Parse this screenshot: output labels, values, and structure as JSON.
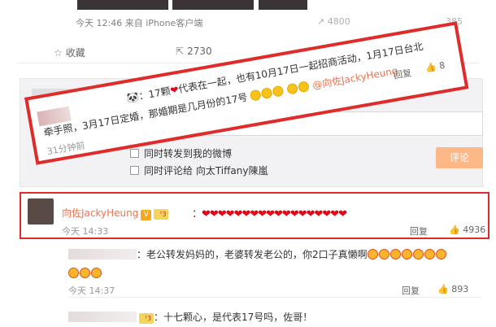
{
  "post": {
    "meta": "今天 12:46 来自 iPhone客户端",
    "share_count_partial": "4800",
    "like_count_partial": "385"
  },
  "actions": {
    "favorite": "收藏",
    "repost_count": "2730"
  },
  "composer": {
    "option_repost": "同时转发到我的微博",
    "option_comment": "同时评论给 向太Tiffany陳嵐",
    "submit": "评论"
  },
  "highlighted_reply": {
    "line1_prefix": "：17颗",
    "line1_mid": "代表在一起，也有10月17日一起招商活动，1月17日台北",
    "mention": "@向佐JackyHeung",
    "line2": "牵手照，3月17日定婚，那婚期是几月份的17号",
    "time": "31分钟前",
    "reply": "回复",
    "likes": "8"
  },
  "comment_main": {
    "author": "向佐JackyHeung",
    "badge_v": "V",
    "badge_level": "ᅵ3",
    "hearts": "：❤❤❤❤❤❤❤❤❤❤❤❤❤❤❤❤❤❤",
    "time": "今天 14:33",
    "reply": "回复",
    "likes": "4936"
  },
  "sub_comments": [
    {
      "text": "：老公转发妈妈的，老婆转发老公的，你2口子真懒啊",
      "time": "今天 14:37",
      "reply": "回复",
      "likes": "893"
    },
    {
      "text": "：十七颗心，是代表17号吗，佐哥！"
    }
  ]
}
